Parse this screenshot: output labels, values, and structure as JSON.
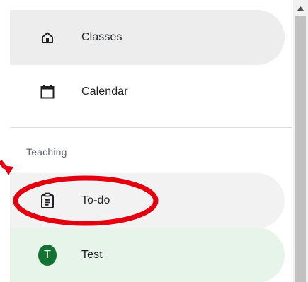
{
  "nav": {
    "items": [
      {
        "label": "Classes",
        "icon": "home-icon",
        "selected": false
      },
      {
        "label": "Calendar",
        "icon": "calendar-icon",
        "selected": false
      },
      {
        "label": "To-do",
        "icon": "assignment-icon",
        "selected": false
      },
      {
        "label": "Test",
        "icon": "avatar",
        "avatar_letter": "T",
        "selected": true
      }
    ],
    "section_label": "Teaching"
  },
  "colors": {
    "hover_bg": "#ededed",
    "selected_bg": "#e6f4ea",
    "avatar_bg": "#137333",
    "annotation_red": "#e3000f",
    "text": "#202124",
    "section_text": "#5f6368"
  },
  "scrollbar": {
    "up_arrow_icon": "triangle-up-icon"
  }
}
